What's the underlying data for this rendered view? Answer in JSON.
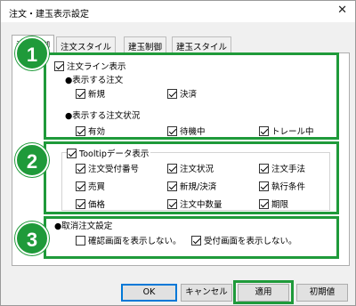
{
  "window": {
    "title": "注文・建玉表示設定",
    "close_icon": "✕"
  },
  "tabs": [
    "注文制御",
    "注文スタイル",
    "建玉制御",
    "建玉スタイル"
  ],
  "badges": [
    "1",
    "2",
    "3"
  ],
  "section1": {
    "order_line": {
      "label": "注文ライン表示",
      "checked": true
    },
    "display_orders_label": "●表示する注文",
    "display_orders": [
      {
        "label": "新規",
        "checked": true
      },
      {
        "label": "決済",
        "checked": true
      }
    ],
    "display_status_label": "●表示する注文状況",
    "display_status": [
      {
        "label": "有効",
        "checked": true
      },
      {
        "label": "待機中",
        "checked": true
      },
      {
        "label": "トレール中",
        "checked": true
      }
    ]
  },
  "section2": {
    "tooltip": {
      "label": "Tooltipデータ表示",
      "checked": true
    },
    "items": [
      {
        "label": "注文受付番号",
        "checked": true
      },
      {
        "label": "注文状況",
        "checked": true
      },
      {
        "label": "注文手法",
        "checked": true
      },
      {
        "label": "売買",
        "checked": true
      },
      {
        "label": "新規/決済",
        "checked": true
      },
      {
        "label": "執行条件",
        "checked": true
      },
      {
        "label": "価格",
        "checked": true
      },
      {
        "label": "注文中数量",
        "checked": true
      },
      {
        "label": "期限",
        "checked": true
      }
    ]
  },
  "section3": {
    "title": "●取消注文設定",
    "items": [
      {
        "label": "確認画面を表示しない。",
        "checked": false
      },
      {
        "label": "受付画面を表示しない。",
        "checked": true
      }
    ]
  },
  "buttons": {
    "ok": "OK",
    "cancel": "キャンセル",
    "apply": "適用",
    "reset": "初期値"
  },
  "colors": {
    "highlight": "#1f9a3a"
  }
}
